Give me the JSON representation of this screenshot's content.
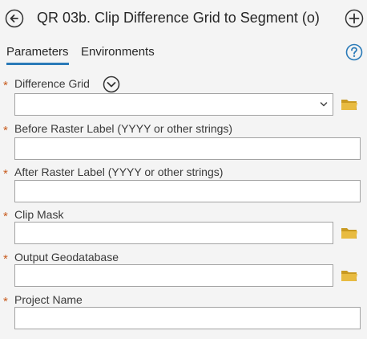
{
  "header": {
    "title": "QR 03b. Clip Difference Grid to Segment (o)"
  },
  "tabs": [
    {
      "label": "Parameters",
      "active": true
    },
    {
      "label": "Environments",
      "active": false
    }
  ],
  "required_marker": "*",
  "params": {
    "difference_grid": {
      "label": "Difference Grid",
      "value": ""
    },
    "before_label": {
      "label": "Before Raster Label (YYYY or other strings)",
      "value": ""
    },
    "after_label": {
      "label": "After Raster Label (YYYY or other strings)",
      "value": ""
    },
    "clip_mask": {
      "label": "Clip Mask",
      "value": ""
    },
    "output_gdb": {
      "label": "Output Geodatabase",
      "value": ""
    },
    "project_name": {
      "label": "Project Name",
      "value": ""
    }
  },
  "colors": {
    "accent": "#2a7ab8",
    "required": "#c75b1e",
    "folder": "#d9a92a"
  }
}
